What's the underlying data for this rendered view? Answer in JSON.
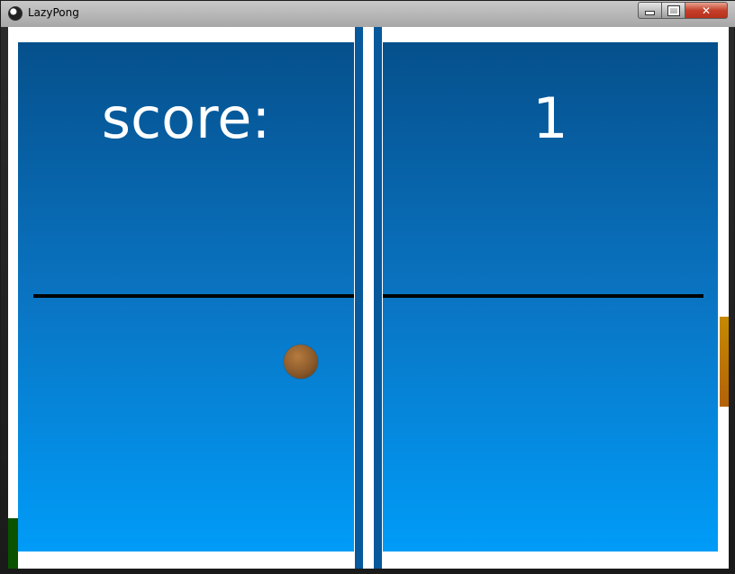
{
  "window": {
    "title": "LazyPong",
    "icon": "lazypong-app-icon",
    "controls": [
      "minimize",
      "maximize",
      "close"
    ]
  },
  "game": {
    "score_label": "score:",
    "score_value": "1"
  },
  "colors": {
    "court_top": "#05508c",
    "court_bottom": "#009cf8",
    "ball": "#8b5a2b",
    "left_paddle": "#0a5200",
    "right_paddle": "#c68a00",
    "net": "#000000"
  }
}
